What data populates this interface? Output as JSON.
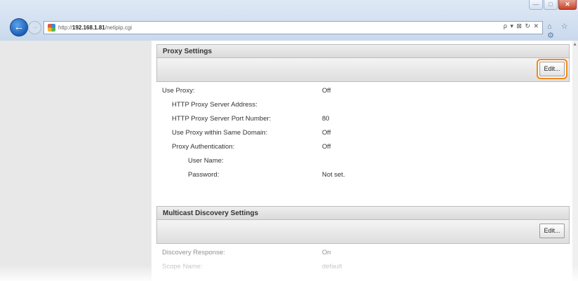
{
  "browser": {
    "url_prefix": "http://",
    "url_host": "192.168.1.81",
    "url_path": "/netipip.cgi",
    "address_tools": "ρ ▾ ⊠ ↻ ✕",
    "toolbar_icons": "⌂ ☆ ⚙",
    "back_glyph": "←",
    "forward_glyph": "→",
    "window_buttons": {
      "minimize": "—",
      "maximize": "□",
      "close": "✕"
    }
  },
  "proxy": {
    "header": "Proxy Settings",
    "edit_label": "Edit...",
    "rows": [
      {
        "label": "Use Proxy:",
        "value": "Off"
      },
      {
        "label": "HTTP Proxy Server Address:",
        "value": ""
      },
      {
        "label": "HTTP Proxy Server Port Number:",
        "value": "80"
      },
      {
        "label": "Use Proxy within Same Domain:",
        "value": "Off"
      },
      {
        "label": "Proxy Authentication:",
        "value": "Off"
      },
      {
        "label": "User Name:",
        "value": ""
      },
      {
        "label": "Password:",
        "value": "Not set."
      }
    ]
  },
  "multicast": {
    "header": "Multicast Discovery Settings",
    "edit_label": "Edit...",
    "rows": [
      {
        "label": "Discovery Response:",
        "value": "On"
      },
      {
        "label": "Scope Name:",
        "value": "default"
      }
    ]
  },
  "colors": {
    "highlight": "#f08a1e",
    "back_button": "#1e5fb8",
    "sidebar": "#e8e8e8"
  }
}
